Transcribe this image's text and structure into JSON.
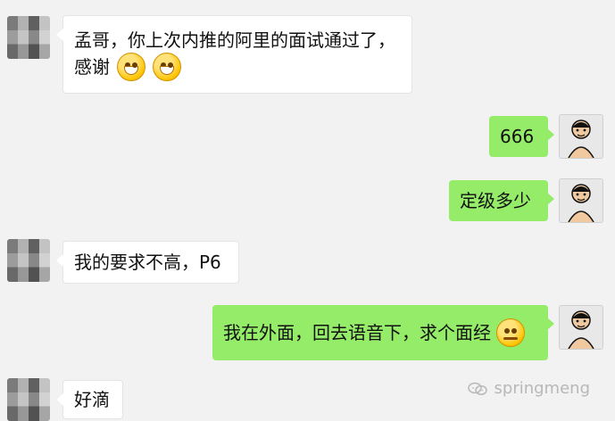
{
  "chat": {
    "messages": [
      {
        "side": "left",
        "text": "孟哥，你上次内推的阿里的面试通过了，",
        "text2": "感谢",
        "emoji": "grinning-face-icon"
      },
      {
        "side": "right",
        "text": "666"
      },
      {
        "side": "right",
        "text": "定级多少"
      },
      {
        "side": "left",
        "text": "我的要求不高，P6"
      },
      {
        "side": "right",
        "text": "我在外面，回去语音下，求个面经",
        "emoji": "thinking-face-icon"
      },
      {
        "side": "left",
        "text": "好滴"
      }
    ]
  },
  "watermark": {
    "text": "springmeng",
    "icon": "wechat-icon"
  },
  "colors": {
    "background": "#f2f2f2",
    "incoming_bubble": "#ffffff",
    "outgoing_bubble": "#95ec69"
  }
}
